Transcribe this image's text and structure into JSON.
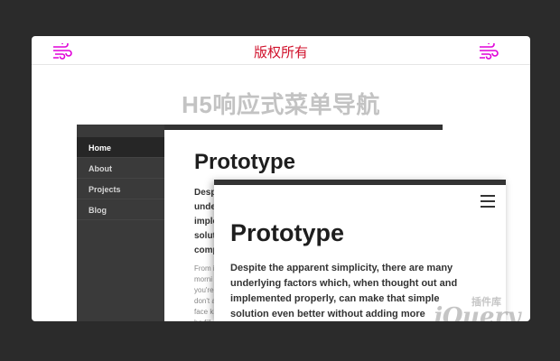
{
  "header": {
    "title": "版权所有",
    "left_icon": "wind-icon",
    "right_icon": "wind-icon",
    "accent_color": "#d0112b",
    "icon_color": "#e000d8"
  },
  "headline": "H5响应式菜单导航",
  "desktop": {
    "nav": [
      "Home",
      "About",
      "Projects",
      "Blog"
    ],
    "active_index": 0,
    "title": "Prototype",
    "lead": "Desp\nunder\nimple\nsolut\ncomp",
    "body": "From i\nmorni\nyou're\ndon't a\nface ki\nbe fill"
  },
  "mobile": {
    "menu_icon": "hamburger-icon",
    "title": "Prototype",
    "lead": "Despite the apparent simplicity, there are many\nunderlying factors which, when thought out and\nimplemented properly, can make that simple\nsolution even better without adding more"
  },
  "watermark": {
    "text": "jQuery",
    "sub": "插件库"
  }
}
